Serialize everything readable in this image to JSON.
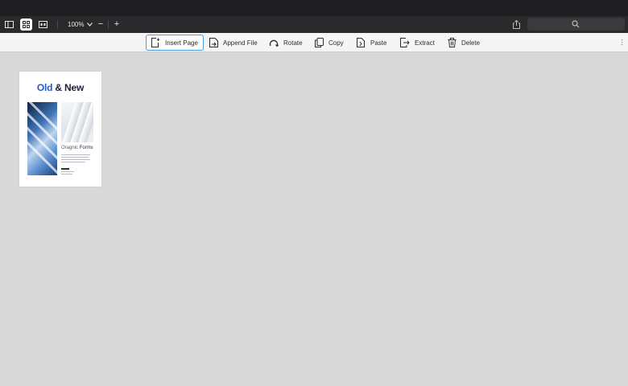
{
  "topbar": {
    "zoom_level": "100%",
    "zoom_out_symbol": "−",
    "zoom_in_symbol": "+",
    "icons": [
      "sidebar-icon",
      "grid-view-icon",
      "page-view-icon",
      "chevron-down-icon",
      "share-icon",
      "search-icon"
    ]
  },
  "toolbar": {
    "tools": [
      {
        "label": "Insert Page",
        "icon": "insert-page-icon",
        "selected": true
      },
      {
        "label": "Append File",
        "icon": "append-file-icon",
        "selected": false
      },
      {
        "label": "Rotate",
        "icon": "rotate-icon",
        "selected": false
      },
      {
        "label": "Copy",
        "icon": "copy-icon",
        "selected": false
      },
      {
        "label": "Paste",
        "icon": "paste-icon",
        "selected": false
      },
      {
        "label": "Extract",
        "icon": "extract-icon",
        "selected": false
      },
      {
        "label": "Delete",
        "icon": "trash-icon",
        "selected": false
      }
    ]
  },
  "page_thumbnail": {
    "title_highlight": "Old",
    "title_rest": " & New",
    "subtitle_plain": "Oragnic ",
    "subtitle_bold": "Forms"
  },
  "colors": {
    "accent_blue": "#1d5fd0",
    "selection_border": "#4a9be0",
    "topbar_bg": "#2a2a2d",
    "canvas_bg": "#d8d8d8"
  }
}
